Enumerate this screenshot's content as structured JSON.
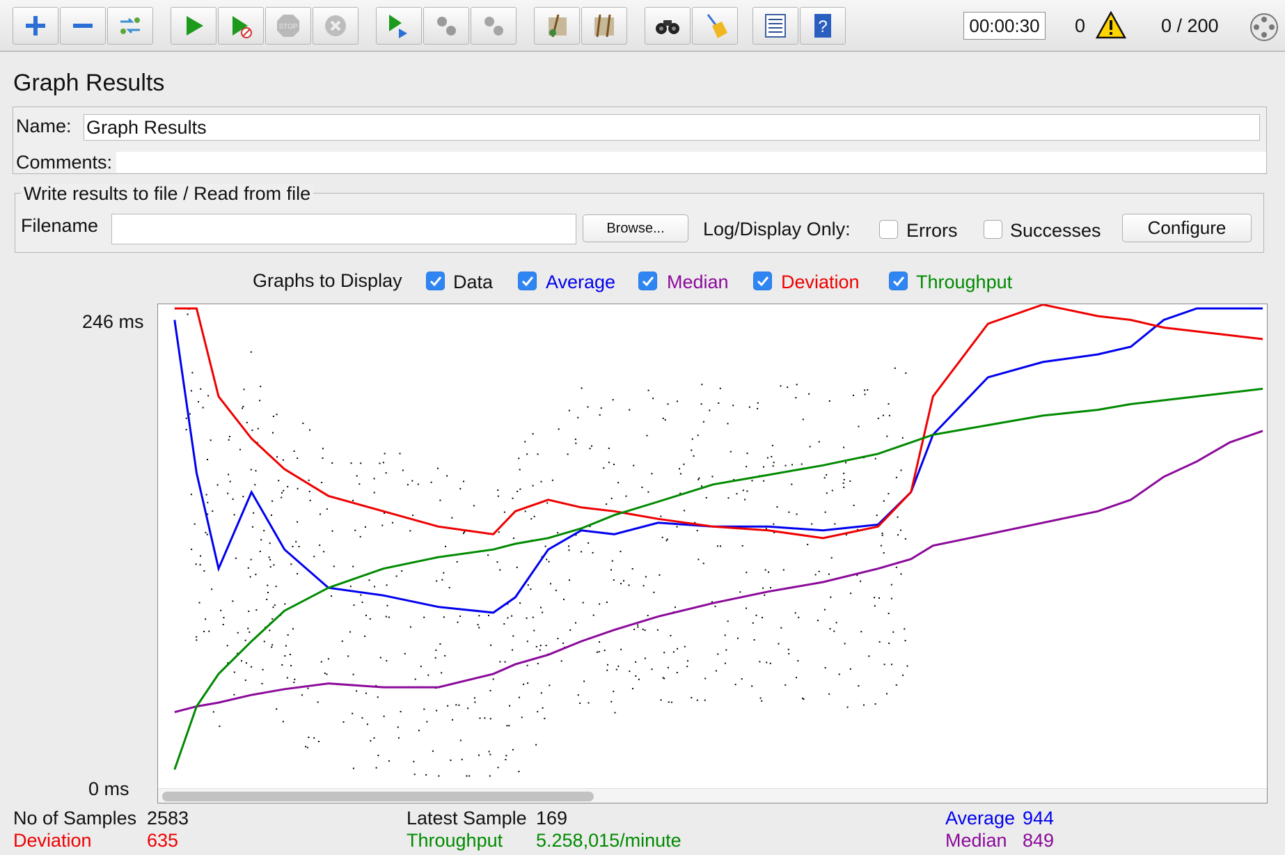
{
  "toolbar": {
    "buttons": [
      "add",
      "remove",
      "toggle",
      "start",
      "start-no-pauses",
      "stop",
      "shutdown",
      "remote-start-all",
      "remote-stop-all",
      "remote-shutdown-all",
      "clear",
      "clear-all",
      "search",
      "reset-search",
      "function-helper",
      "help"
    ],
    "timer": "00:00:30",
    "error_count": "0",
    "threads": "0 / 200"
  },
  "panel": {
    "title": "Graph Results",
    "name_label": "Name:",
    "name_value": "Graph Results",
    "comments_label": "Comments:",
    "comments_value": "",
    "file_group_title": "Write results to file / Read from file",
    "filename_label": "Filename",
    "filename_value": "",
    "browse_label": "Browse...",
    "log_display_label": "Log/Display Only:",
    "errors_label": "Errors",
    "errors_checked": false,
    "successes_label": "Successes",
    "successes_checked": false,
    "configure_label": "Configure"
  },
  "graphs_to_display": {
    "label": "Graphs to Display",
    "data": {
      "label": "Data",
      "checked": true,
      "color": "#000000"
    },
    "average": {
      "label": "Average",
      "checked": true,
      "color": "#0000ee"
    },
    "median": {
      "label": "Median",
      "checked": true,
      "color": "#8b0a9a"
    },
    "deviation": {
      "label": "Deviation",
      "checked": true,
      "color": "#ee0000"
    },
    "throughput": {
      "label": "Throughput",
      "checked": true,
      "color": "#008a00"
    }
  },
  "graph": {
    "y_max_label": "246  ms",
    "y_min_label": "0  ms"
  },
  "chart_data": {
    "type": "line",
    "ylim": [
      0,
      246
    ],
    "y_unit": "ms",
    "x": [
      0.01,
      0.03,
      0.05,
      0.08,
      0.11,
      0.15,
      0.2,
      0.25,
      0.3,
      0.32,
      0.35,
      0.38,
      0.41,
      0.45,
      0.5,
      0.55,
      0.6,
      0.65,
      0.68,
      0.7,
      0.75,
      0.8,
      0.85,
      0.88,
      0.91,
      0.94,
      0.97,
      1.0
    ],
    "series": [
      {
        "name": "Average",
        "values": [
          240,
          160,
          110,
          150,
          120,
          100,
          96,
          90,
          87,
          95,
          120,
          130,
          128,
          134,
          132,
          132,
          130,
          133,
          150,
          180,
          210,
          218,
          222,
          226,
          240,
          246,
          246,
          246
        ]
      },
      {
        "name": "Median",
        "values": [
          35,
          38,
          40,
          44,
          47,
          50,
          48,
          48,
          55,
          60,
          65,
          72,
          78,
          85,
          92,
          98,
          103,
          110,
          115,
          122,
          128,
          134,
          140,
          146,
          158,
          166,
          176,
          182
        ]
      },
      {
        "name": "Deviation",
        "values": [
          246,
          246,
          200,
          178,
          162,
          148,
          140,
          132,
          128,
          140,
          146,
          142,
          140,
          136,
          132,
          130,
          126,
          132,
          150,
          200,
          238,
          248,
          242,
          240,
          236,
          234,
          232,
          230
        ]
      },
      {
        "name": "Throughput",
        "values": [
          5,
          38,
          55,
          72,
          88,
          100,
          110,
          116,
          120,
          123,
          126,
          131,
          138,
          145,
          154,
          159,
          164,
          170,
          176,
          180,
          185,
          190,
          193,
          196,
          198,
          200,
          202,
          204
        ]
      }
    ]
  },
  "stats": {
    "samples_label": "No of Samples",
    "samples_value": "2583",
    "latest_label": "Latest Sample",
    "latest_value": "169",
    "average_label": "Average",
    "average_value": "944",
    "deviation_label": "Deviation",
    "deviation_value": "635",
    "throughput_label": "Throughput",
    "throughput_value": "5.258,015/minute",
    "median_label": "Median",
    "median_value": "849"
  }
}
